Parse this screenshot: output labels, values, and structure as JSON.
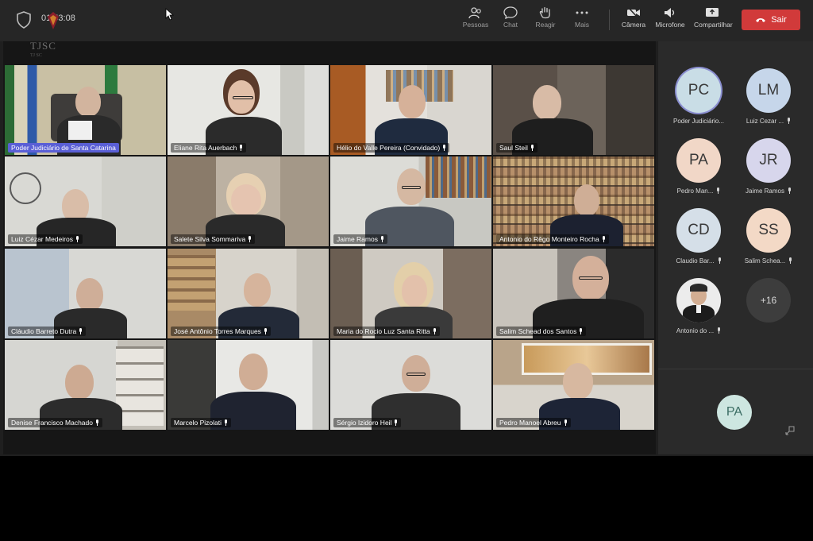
{
  "meeting": {
    "timer": "01:53:08",
    "logo_text": "TJSC",
    "logo_sub": "TJ SC"
  },
  "toolbar": {
    "people": "Pessoas",
    "chat": "Chat",
    "react": "Reagir",
    "more": "Mais",
    "camera": "Câmera",
    "mic": "Microfone",
    "share": "Compartilhar",
    "leave": "Sair"
  },
  "colors": {
    "leave_button": "#d13a3a",
    "active_speaker": "#5a5fd6",
    "topbar": "#262626"
  },
  "grid": [
    {
      "name": "Poder Judiciário de Santa Catarina",
      "active": true
    },
    {
      "name": "Eliane Rita Auerbach"
    },
    {
      "name": "Hélio do Valle Pereira (Convidado)"
    },
    {
      "name": "Saul Steil"
    },
    {
      "name": "Luiz Cézar Medeiros"
    },
    {
      "name": "Salete Silva Sommariva"
    },
    {
      "name": "Jaime Ramos"
    },
    {
      "name": "Antonio do Rêgo Monteiro Rocha"
    },
    {
      "name": "Cláudio Barreto Dutra"
    },
    {
      "name": "José Antônio Torres Marques"
    },
    {
      "name": "Maria do Rocio Luz Santa Ritta"
    },
    {
      "name": "Salim Schead dos Santos"
    },
    {
      "name": "Denise Francisco Machado"
    },
    {
      "name": "Marcelo Pizolati"
    },
    {
      "name": "Sérgio Izidoro Heil"
    },
    {
      "name": "Pedro Manoel Abreu"
    }
  ],
  "sidebar": {
    "participants": [
      {
        "initials": "PC",
        "name": "Poder Judiciário...",
        "bg": "#c9dde6",
        "active": true
      },
      {
        "initials": "LM",
        "name": "Luiz Cezar ...",
        "bg": "#c6d6ea"
      },
      {
        "initials": "PA",
        "name": "Pedro Man...",
        "bg": "#f1d7c7"
      },
      {
        "initials": "JR",
        "name": "Jaime Ramos",
        "bg": "#d7d6ec"
      },
      {
        "initials": "CD",
        "name": "Claudio Bar...",
        "bg": "#d5dfe8"
      },
      {
        "initials": "SS",
        "name": "Salim Schea...",
        "bg": "#f3d9c6"
      },
      {
        "initials": "",
        "name": "Antonio do ...",
        "bg": "#e9e9e9",
        "photo": true
      },
      {
        "initials": "+16",
        "name": "",
        "more": true
      }
    ],
    "self_initials": "PA"
  }
}
